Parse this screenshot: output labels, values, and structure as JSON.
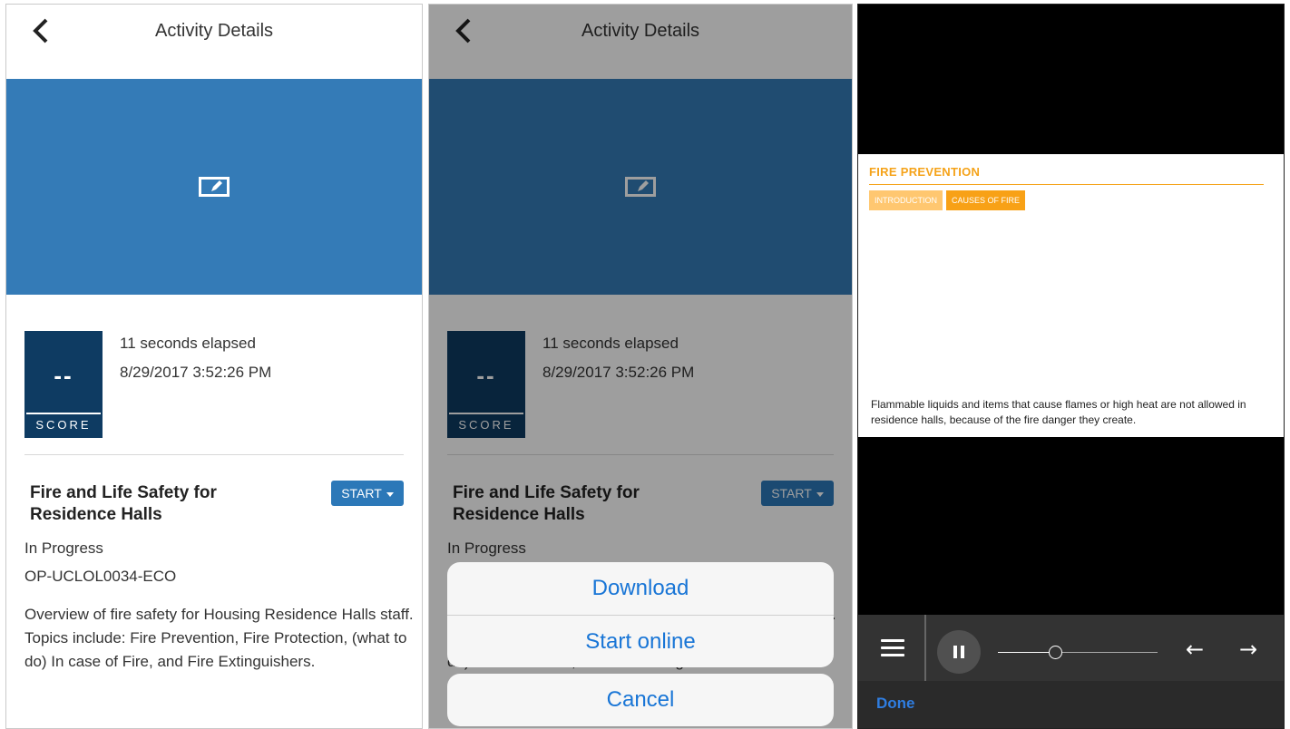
{
  "activity_screen": {
    "nav_title": "Activity Details",
    "score_value": "--",
    "score_label": "SCORE",
    "elapsed": "11 seconds elapsed",
    "timestamp": "8/29/2017 3:52:26 PM",
    "course_title": "Fire and Life Safety for Residence Halls",
    "start_label": "START",
    "status": "In Progress",
    "course_code": "OP-UCLOL0034-ECO",
    "description": "Overview of fire safety for Housing Residence Halls staff. Topics include: Fire Prevention, Fire Protection, (what to do) In case of Fire, and Fire Extinguishers."
  },
  "action_sheet": {
    "download_label": "Download",
    "start_online_label": "Start online",
    "cancel_label": "Cancel"
  },
  "player": {
    "slide_title": "FIRE PREVENTION",
    "tabs": [
      "INTRODUCTION",
      "CAUSES OF FIRE"
    ],
    "caption": "Flammable liquids and items that cause flames or high heat are not allowed in residence halls, because of the fire danger they create.",
    "progress_fraction": 0.36,
    "done_label": "Done"
  },
  "colors": {
    "hero_blue": "#347bb7",
    "score_navy": "#0e3b62",
    "start_button": "#2c78b8",
    "sheet_text": "#1875d6",
    "slide_orange": "#f5a31a",
    "player_bar": "#333333",
    "done_blue": "#2f7de0"
  },
  "icons": {
    "back": "chevron-left-icon",
    "hero": "edit-screen-icon",
    "menu": "hamburger-menu-icon",
    "pause": "pause-icon",
    "previous": "arrow-left-icon",
    "next": "arrow-right-icon"
  }
}
